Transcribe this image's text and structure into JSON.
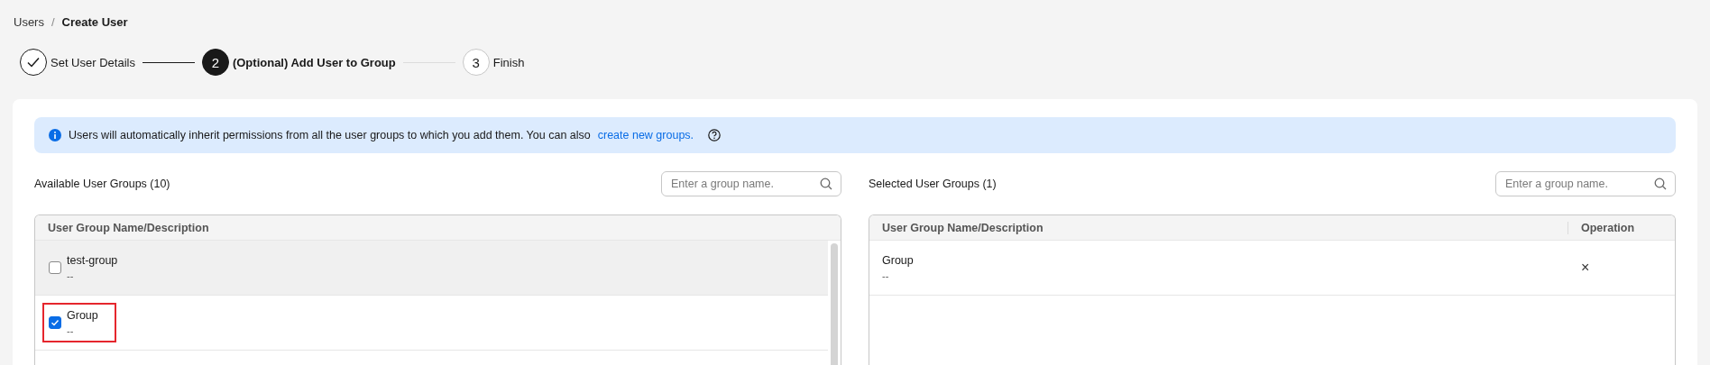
{
  "breadcrumb": [
    {
      "label": "Users",
      "current": false
    },
    {
      "label": "Create User",
      "current": true
    }
  ],
  "breadcrumb_separator": "/",
  "steps": [
    {
      "label": "Set User Details",
      "done": true,
      "current": false
    },
    {
      "label": "(Optional) Add User to Group",
      "number": "2",
      "done": false,
      "current": true
    },
    {
      "label": "Finish",
      "number": "3",
      "done": false,
      "current": false
    }
  ],
  "info": {
    "text": "Users will automatically inherit permissions from all the user groups to which you add them. You can also",
    "link": "create new groups."
  },
  "available": {
    "title": "Available User Groups (10)",
    "search": {
      "placeholder": "Enter a group name."
    },
    "columns": [
      "User Group Name/Description"
    ],
    "rows": [
      {
        "name": "test-group",
        "description": "--",
        "checked": false,
        "hovered": true,
        "highlighted": false
      },
      {
        "name": "Group",
        "description": "--",
        "checked": true,
        "hovered": false,
        "highlighted": true
      }
    ]
  },
  "selected": {
    "title": "Selected User Groups (1)",
    "search": {
      "placeholder": "Enter a group name."
    },
    "columns": [
      "User Group Name/Description",
      "Operation"
    ],
    "rows": [
      {
        "name": "Group",
        "description": "--",
        "remove": "×"
      }
    ]
  }
}
